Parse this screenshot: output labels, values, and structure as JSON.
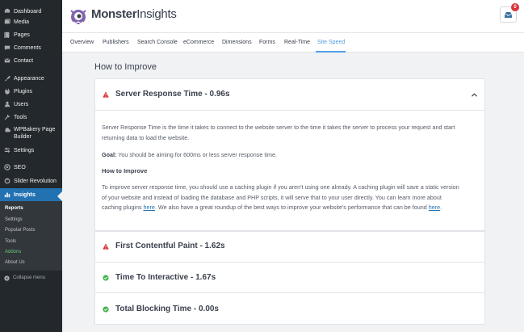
{
  "sidebar": {
    "items": [
      {
        "label": "Dashboard",
        "icon": "dashboard-icon"
      },
      {
        "label": "Media",
        "icon": "media-icon"
      },
      {
        "label": "Pages",
        "icon": "pages-icon"
      },
      {
        "label": "Comments",
        "icon": "comments-icon"
      },
      {
        "label": "Contact",
        "icon": "mail-icon"
      },
      {
        "label": "Appearance",
        "icon": "paintbrush-icon"
      },
      {
        "label": "Plugins",
        "icon": "plugin-icon"
      },
      {
        "label": "Users",
        "icon": "users-icon"
      },
      {
        "label": "Tools",
        "icon": "wrench-icon"
      },
      {
        "label": "WPBakery Page Builder",
        "line1": "WPBakery Page",
        "line2": "Builder",
        "icon": "wpbakery-icon"
      },
      {
        "label": "Settings",
        "icon": "settings-icon"
      },
      {
        "label": "SEO",
        "icon": "seo-icon"
      },
      {
        "label": "Slider Revolution",
        "icon": "slider-icon"
      },
      {
        "label": "Insights",
        "icon": "insights-icon"
      }
    ],
    "submenu": [
      "Reports",
      "Settings",
      "Popular Posts",
      "Tools",
      "Addons",
      "About Us"
    ],
    "collapse_label": "Collapse menu"
  },
  "header": {
    "brand_part1": "Monster",
    "brand_part2": "Insights",
    "notification_count": "0"
  },
  "tabs": [
    "Overview",
    "Publishers",
    "Search Console",
    "eCommerce",
    "Dimensions",
    "Forms",
    "Real-Time",
    "Site Speed"
  ],
  "active_tab": "Site Speed",
  "content": {
    "section_title": "How to Improve",
    "panels": [
      {
        "title": "Server Response Time - 0.96s",
        "status": "warning",
        "expanded": true
      },
      {
        "title": "First Contentful Paint - 1.62s",
        "status": "warning",
        "expanded": false
      },
      {
        "title": "Time To Interactive - 1.67s",
        "status": "good",
        "expanded": false
      },
      {
        "title": "Total Blocking Time - 0.00s",
        "status": "good",
        "expanded": false
      }
    ],
    "description_line1": "Server Response Time is the time it takes to connect to the website server to the time it takes the server to process your request and start",
    "description_line2": "returning data to load the website.",
    "goal_label": "Goal:",
    "goal_text": " You should be aiming for 600ms or less server response time.",
    "how_to_title": "How to Improve",
    "improve_line1": "To improve server response time, you should use a caching plugin if you aren't using one already. A caching plugin will save a static version",
    "improve_line2": "of your website and instead of loading the database and PHP scripts, it will serve that to your user directly. You can learn more about",
    "improve_line3a": "caching plugins ",
    "link1": "here",
    "improve_line3b": ". We also have a great roundup of the best ways to improve your website's performance that can be found ",
    "link2": "here",
    "improve_line3c": "."
  },
  "colors": {
    "sidebar_bg": "#23282d",
    "accent_blue": "#2271b1",
    "tab_active": "#509fe2",
    "warning_red": "#d63638",
    "success_green": "#46b450"
  }
}
